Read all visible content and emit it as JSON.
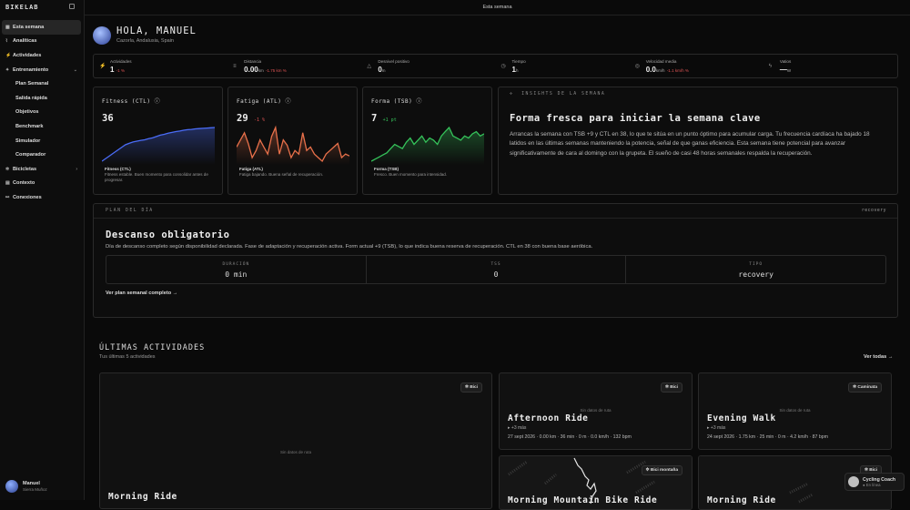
{
  "app": {
    "logo": "BIKELAB",
    "page_title": "Esta semana"
  },
  "sidebar": {
    "items": [
      {
        "label": "Esta semana",
        "icon": "calendar-icon"
      },
      {
        "label": "Analíticas",
        "icon": "chart-icon"
      },
      {
        "label": "Actividades",
        "icon": "activity-icon"
      },
      {
        "label": "Entrenamiento",
        "icon": "gear-icon"
      },
      {
        "label": "Plan Semanal"
      },
      {
        "label": "Salida rápida"
      },
      {
        "label": "Objetivos"
      },
      {
        "label": "Benchmark"
      },
      {
        "label": "Simulador"
      },
      {
        "label": "Comparador"
      },
      {
        "label": "Bicicletas",
        "icon": "bike-icon"
      },
      {
        "label": "Contexto",
        "icon": "doc-icon"
      },
      {
        "label": "Conexiones",
        "icon": "link-icon"
      }
    ],
    "user": {
      "name": "Manuel",
      "location": "Sierra Muñoz"
    }
  },
  "header": {
    "greeting": "HOLA, MANUEL",
    "location": "Cazorla, Andalusia, Spain"
  },
  "stats": [
    {
      "label": "Actividades",
      "value": "1",
      "unit": "",
      "delta": "-1 %"
    },
    {
      "label": "Distancia",
      "value": "0.00",
      "unit": "km",
      "delta": "-1.75 km %"
    },
    {
      "label": "Desnivel positivo",
      "value": "0",
      "unit": "m",
      "delta": ""
    },
    {
      "label": "Tiempo",
      "value": "1",
      "unit": "h",
      "delta": ""
    },
    {
      "label": "Velocidad media",
      "value": "0.0",
      "unit": "km/h",
      "delta": "-1.1 km/h %"
    },
    {
      "label": "Vatios",
      "value": "—",
      "unit": "W",
      "delta": ""
    }
  ],
  "fitness": {
    "title": "Fitness (CTL)",
    "value": "36",
    "delta": "",
    "foot_title": "Fitness (CTL)",
    "foot_text": "Fitness estable. Buen momento para consolidar antes de progresar.",
    "color": "#4a6cf7",
    "series": [
      8,
      9,
      10,
      11,
      12,
      13,
      14,
      14.5,
      15,
      15.3,
      15.6,
      15.8,
      16.2,
      16.5,
      17,
      17.5,
      17.8,
      18.2,
      18.5,
      18.8,
      19,
      19.3,
      19.5,
      19.6,
      19.8,
      19.9,
      20,
      20.1,
      20.2,
      20.3
    ]
  },
  "fatigue": {
    "title": "Fatiga (ATL)",
    "value": "29",
    "delta": "-1 %",
    "foot_title": "Fatiga (ATL)",
    "foot_text": "Fatiga bajando. Buena señal de recuperación.",
    "color": "#e8704a",
    "series": [
      14,
      18,
      22,
      16,
      8,
      12,
      18,
      14,
      10,
      20,
      25,
      10,
      18,
      15,
      8,
      12,
      10,
      22,
      12,
      14,
      10,
      8,
      6,
      10,
      12,
      14,
      16,
      8,
      10,
      9
    ]
  },
  "form": {
    "title": "Forma (TSB)",
    "value": "7",
    "delta": "+1 pt",
    "foot_title": "Forma (TSB)",
    "foot_text": "Fresco. Buen momento para intensidad.",
    "color": "#35c25a",
    "series": [
      4,
      5,
      6,
      7,
      8,
      10,
      12,
      11,
      10,
      13,
      15,
      12,
      14,
      16,
      13,
      15,
      14,
      12,
      16,
      18,
      20,
      16,
      15,
      14,
      16,
      15,
      17,
      18,
      16,
      17
    ]
  },
  "insights": {
    "header": "INSIGHTS DE LA SEMANA",
    "title": "Forma fresca para iniciar la semana clave",
    "body": "Arrancas la semana con TSB +9 y CTL en 38, lo que te sitúa en un punto óptimo para acumular carga. Tu frecuencia cardíaca ha bajado 18 latidos en las últimas semanas manteniendo la potencia, señal de que ganas eficiencia. Esta semana tiene potencial para avanzar significativamente de cara al domingo con la grupeta. El sueño de casi 48 horas semanales respalda la recuperación."
  },
  "plan": {
    "header": "PLAN DEL DÍA",
    "tag": "recovery",
    "title": "Descanso obligatorio",
    "desc": "Día de descanso completo según disponibilidad declarada. Fase de adaptación y recuperación activa. Form actual +9 (TSB), lo que indica buena reserva de recuperación. CTL en 38 con buena base aeróbica.",
    "metrics": [
      {
        "label": "DURACIÓN",
        "value": "0 min"
      },
      {
        "label": "TSS",
        "value": "0"
      },
      {
        "label": "TIPO",
        "value": "recovery"
      }
    ],
    "link": "Ver plan semanal completo →"
  },
  "recent": {
    "title": "ÚLTIMAS ACTIVIDADES",
    "subtitle": "Tus últimas 5 actividades",
    "see_all": "Ver todas →",
    "cards": [
      {
        "badge": "Bici",
        "title": "Morning Ride",
        "noroute": "Sin datos de ruta",
        "more": "",
        "meta": ""
      },
      {
        "badge": "Bici",
        "title": "Afternoon Ride",
        "noroute": "Sin datos de ruta",
        "more": "▸ +3 más",
        "meta": "27 sept 2026 · 0.00 km · 36 min · 0 m · 0.0 km/h · 132 bpm"
      },
      {
        "badge": "Caminata",
        "title": "Evening Walk",
        "noroute": "Sin datos de ruta",
        "more": "▸ +3 más",
        "meta": "24 sept 2026 · 1.75 km · 25 min · 0 m · 4.2 km/h · 87 bpm"
      },
      {
        "badge": "Bici montaña",
        "title": "Morning Mountain Bike Ride",
        "noroute": "",
        "more": "",
        "meta": ""
      },
      {
        "badge": "Bici",
        "title": "Morning Ride",
        "noroute": "",
        "more": "",
        "meta": ""
      }
    ]
  },
  "coach": {
    "name": "Cycling Coach",
    "status": "● En línea"
  }
}
